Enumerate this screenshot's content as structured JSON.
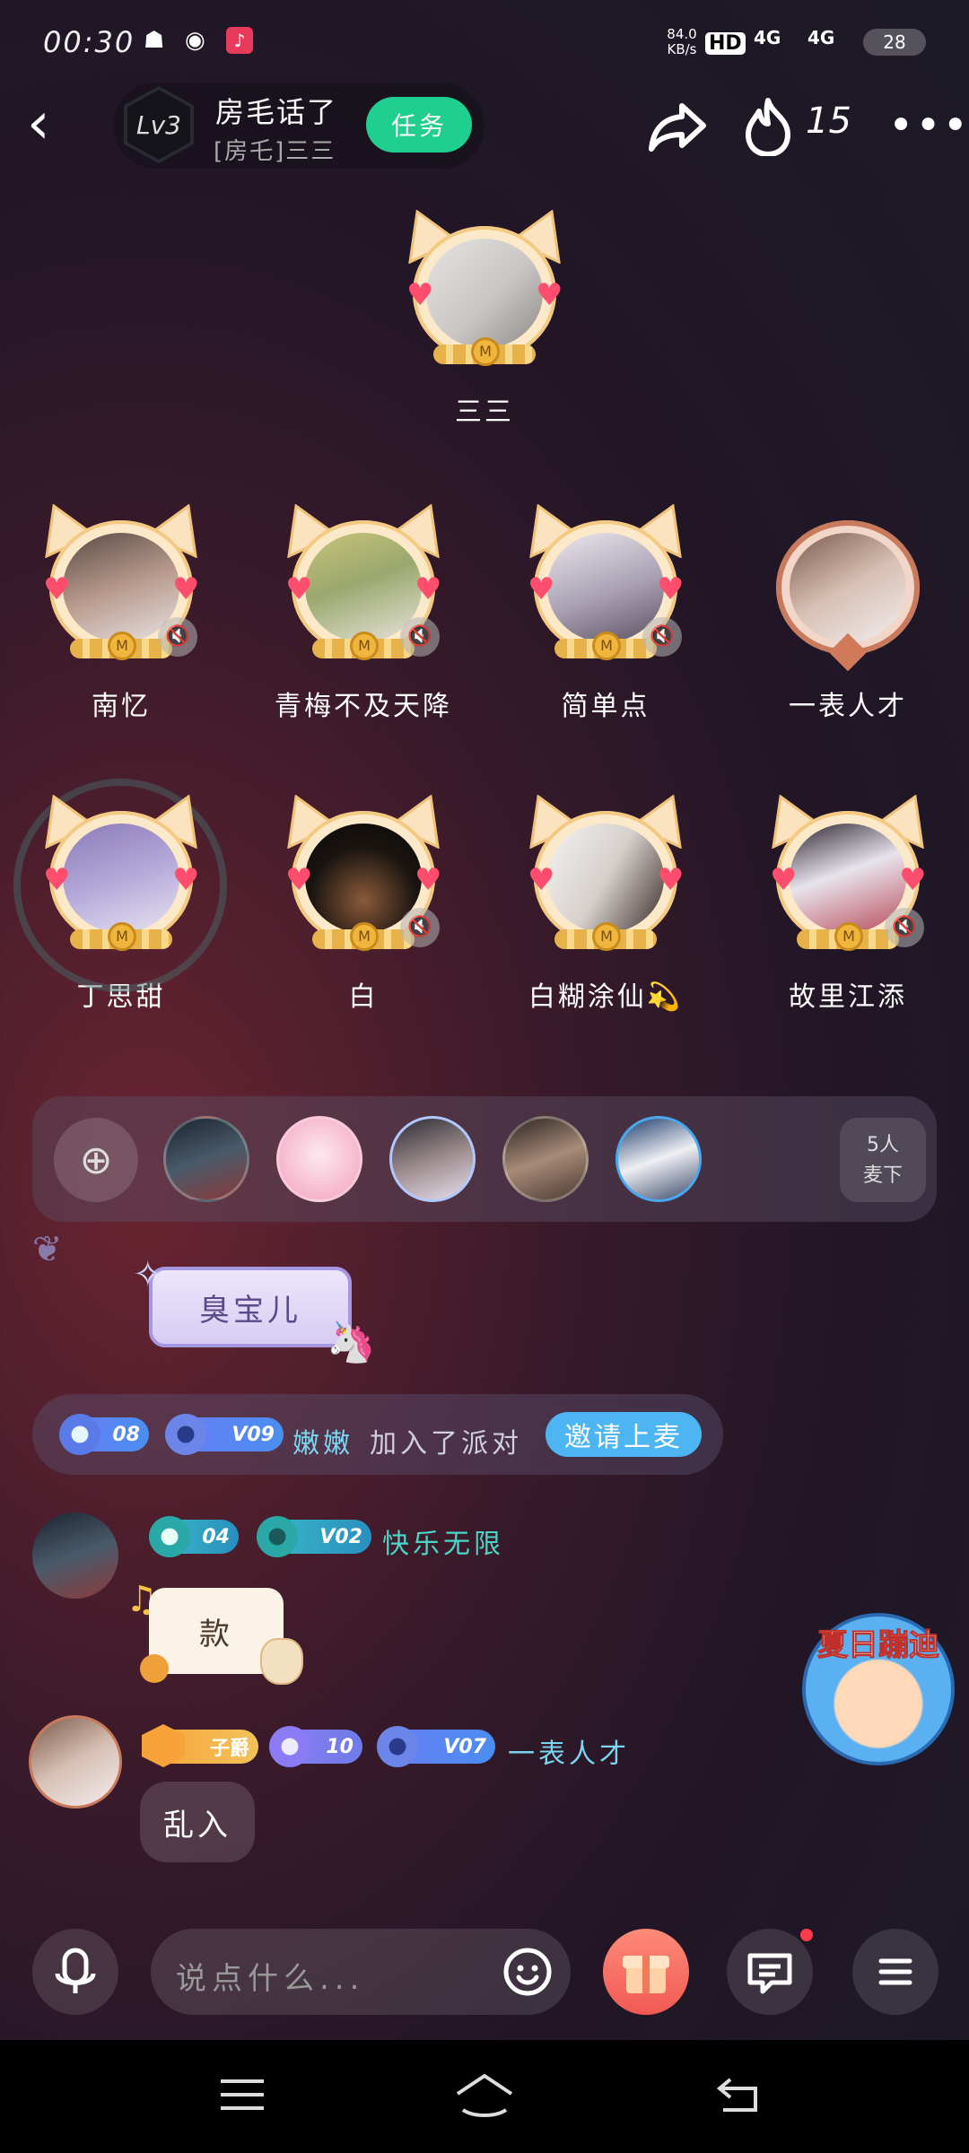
{
  "status_bar": {
    "time": "00:30",
    "net_speed": "84.0 KB/s",
    "hd": "HD",
    "signal1": "4G",
    "signal2": "4G",
    "battery": "28"
  },
  "header": {
    "level": "Lv3",
    "room_name": "房毛话了",
    "room_host": "[房乇]三三",
    "task_label": "任务",
    "popularity": "15"
  },
  "host_seat": {
    "name": "三三"
  },
  "seats": [
    {
      "name": "南忆",
      "muted": true
    },
    {
      "name": "青梅不及天降",
      "muted": true
    },
    {
      "name": "简单点",
      "muted": true
    },
    {
      "name": "一表人才",
      "muted": false
    },
    {
      "name": "丁思甜",
      "muted": false
    },
    {
      "name": "白",
      "muted": true
    },
    {
      "name": "白糊涂仙💫",
      "muted": false
    },
    {
      "name": "故里江添",
      "muted": true
    }
  ],
  "queue": {
    "count_line1": "5人",
    "count_line2": "麦下"
  },
  "chat": {
    "msg1_text": "臭宝儿",
    "system": {
      "badge1": "08",
      "badge2": "V09",
      "user": "嫩嫩",
      "text": "加入了派对",
      "invite_label": "邀请上麦"
    },
    "msg2": {
      "badge1": "04",
      "badge2": "V02",
      "user": "快乐无限",
      "text": "款"
    },
    "msg3": {
      "badge0": "子爵",
      "badge1": "10",
      "badge2": "V07",
      "user": "一表人才",
      "text": "乱入"
    }
  },
  "promo": {
    "label": "夏日蹦迪"
  },
  "input": {
    "placeholder": "说点什么..."
  },
  "colors": {
    "accent_green": "#1fcf8f",
    "invite_blue": "#4db6f2",
    "username_cyan": "#7ad6f0"
  }
}
